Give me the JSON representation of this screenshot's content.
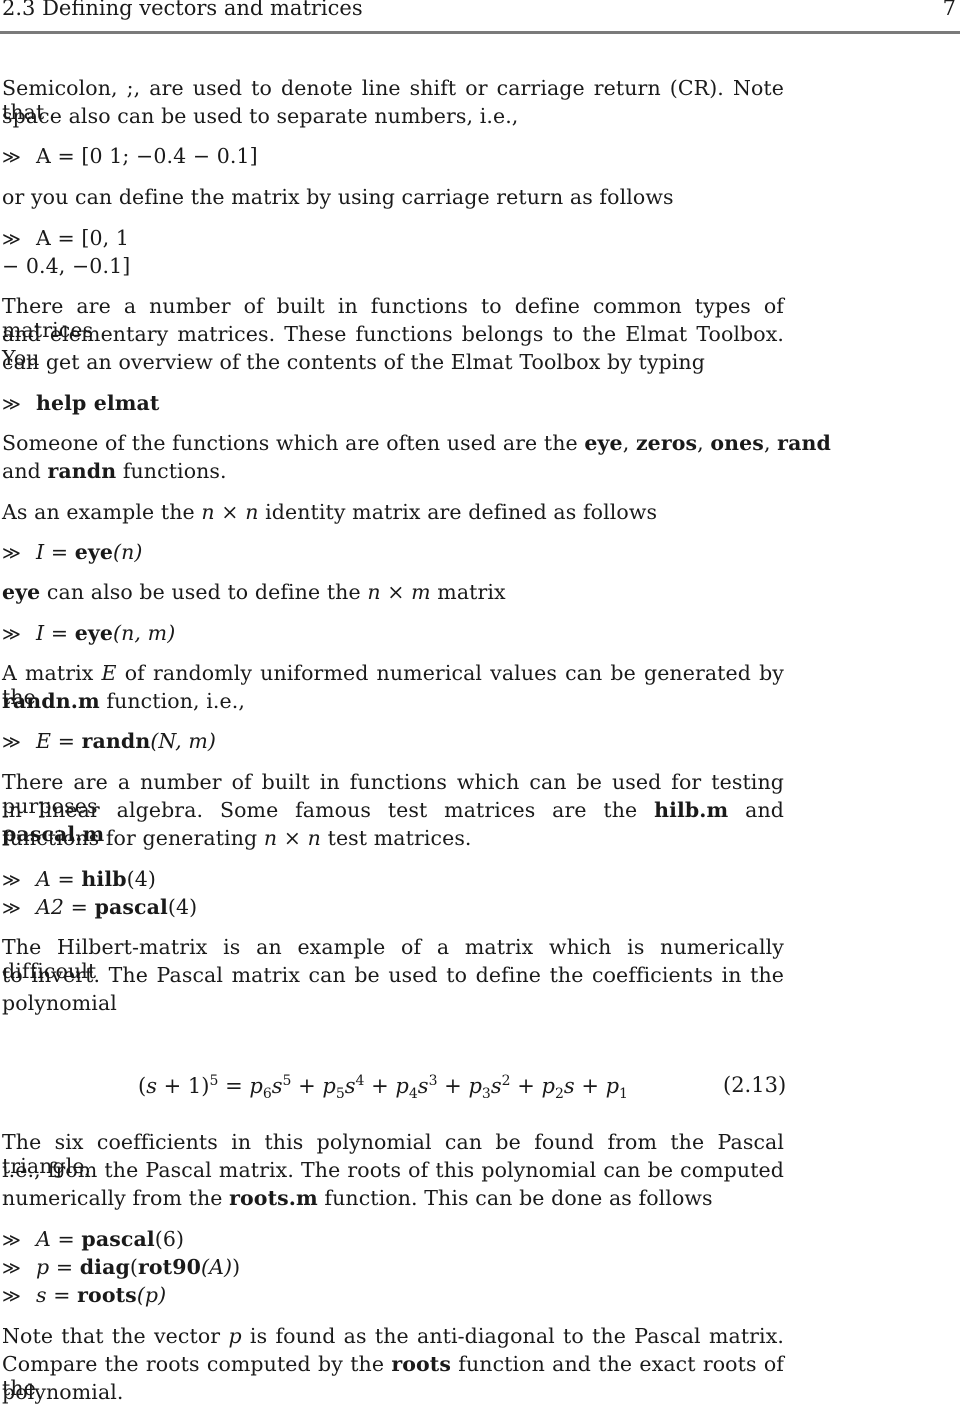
{
  "header": {
    "section_title": "2.3 Defining vectors and matrices",
    "page_number": "7"
  },
  "lines": [
    "Semicolon, ;, are used to denote line shift or carriage return (CR). Note that",
    "space also can be used to separate numbers, i.e.,",
    "A = [0  1; −0.4   − 0.1]",
    "or you can define the matrix by using carriage return as follows",
    "A = [0, 1",
    "− 0.4, −0.1]",
    "There are a number of built in functions to define common types of matrices",
    "and elementary matrices. These functions belongs to the Elmat Toolbox. You",
    "can get an overview of the contents of the Elmat Toolbox by typing",
    "help elmat",
    "Someone of the functions which are often used are the eye, zeros, ones, rand",
    "and randn functions.",
    "As an example the n × n identity matrix are defined as follows",
    "I = eye(n)",
    "eye can also be used to define the n × m matrix",
    "I = eye(n, m)",
    "A matrix E of randomly uniformed numerical values can be generated by the",
    "randn.m function, i.e.,",
    "E = randn(N, m)",
    "There are a number of built in functions which can be used for testing purposes",
    "in linear algebra. Some famous test matrices are the hilb.m and pascal.m",
    "functions for generating n × n test matrices.",
    "A = hilb(4)",
    "A2 = pascal(4)",
    "The Hilbert-matrix is an example of a matrix which is numerically difficoult",
    "to invert. The Pascal matrix can be used to define the coefficients in the",
    "polynomial",
    "The six coefficients in this polynomial can be found from the Pascal triangle,",
    "i.e., from the Pascal matrix. The roots of this polynomial can be computed",
    "numerically from the roots.m function. This can be done as follows",
    "A = pascal(6)",
    "p = diag(rot90(A))",
    "s = roots(p)",
    "Note that the vector p is found as the anti-diagonal to the Pascal matrix.",
    "Compare the roots computed by the roots function and the exact roots of the",
    "polynomial."
  ],
  "prompt_symbol": "≫",
  "equation": {
    "lhs": "(s + 1)",
    "lhs_exp": "5",
    "rhs": "p6 s^5 + p5 s^4 + p4 s^3 + p3 s^2 + p2 s + p1",
    "number": "(2.13)"
  },
  "code": {
    "c1_a": "A = [0  1; −0.4   − 0.1]",
    "c2_a": "A = [0, 1",
    "c2_b": "− 0.4, −0.1]",
    "help": "help elmat",
    "eye1_lhs": "I",
    "eye1_fn": "eye",
    "eye1_arg": "(n)",
    "eye2_fn": "eye",
    "eye2_arg": "(n, m)",
    "randn_lhs": "E",
    "randn_fn": "randn",
    "randn_arg": "(N, m)",
    "hilb_lhs": "A",
    "hilb_fn": "hilb",
    "hilb_arg": "(4)",
    "pascal4_lhs": "A2",
    "pascal4_fn": "pascal",
    "pascal4_arg": "(4)",
    "pascal6_lhs": "A",
    "pascal6_fn": "pascal",
    "pascal6_arg": "(6)",
    "diag_lhs": "p",
    "diag_fn": "diag",
    "rot_fn": "rot90",
    "diag_arg": "(A)",
    "roots_lhs": "s",
    "roots_fn": "roots",
    "roots_arg": "(p)"
  },
  "words": {
    "eye": "eye",
    "zeros": "zeros",
    "ones": "ones",
    "rand": "rand",
    "randn": "randn",
    "randn_m": "randn.m",
    "hilb_m": "hilb.m",
    "pascal_m": "pascal.m",
    "roots_m": "roots.m",
    "roots": "roots",
    "n": "n",
    "m": "m",
    "E": "E",
    "p": "p"
  }
}
